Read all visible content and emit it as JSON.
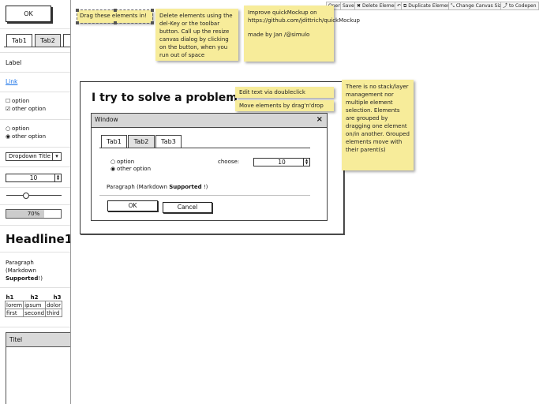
{
  "toolbar": {
    "open": "Open",
    "save": "Save",
    "delete": "Delete Element",
    "undo": "↶",
    "duplicate": "Duplicate Element",
    "resize": "Change Canvas Size",
    "codepen": "to Codepen"
  },
  "palette": {
    "button_label": "OK",
    "tabs": [
      "Tab1",
      "Tab2"
    ],
    "label": "Label",
    "link": "Link",
    "checkboxes": [
      "option",
      "other option"
    ],
    "radios": [
      "option",
      "other option"
    ],
    "dropdown_label": "Dropdown Title",
    "dropdown_arrow": "▾",
    "number_value": "10",
    "slider_value": 0.35,
    "progress_label": "70%",
    "progress_value": 0.7,
    "headline": "Headline1",
    "paragraph_pre": "Paragraph (Markdown ",
    "paragraph_bold": "Supported",
    "paragraph_post": "!)",
    "table": {
      "header": [
        "h1",
        "h2",
        "h3"
      ],
      "rows": [
        [
          "lorem",
          "ipsum",
          "dolor"
        ],
        [
          "first",
          "second",
          "third"
        ]
      ]
    },
    "panel_title": "Titel"
  },
  "notes": {
    "drag": "Drag these elements in!",
    "delete": "Delete elements using the del-Key or the toolbar button. Call up the resize canvas dialog by clicking on the button, when you run out of space",
    "improve_line1": "Improve quickMockup on https://github.com/jdittrich/quickMockup",
    "improve_line2": "made by Jan /@simulo",
    "edit": "Edit text via doubleclick",
    "move": "Move elements by drag'n'drop",
    "group": "There is no stack/layer management nor multiple element selection. Elements are grouped by dragging one element on/in another. Grouped elements move with their parent(s)"
  },
  "canvas": {
    "headline": "I try to solve a problem",
    "window": {
      "title": "Window",
      "close": "×",
      "tabs": [
        "Tab1",
        "Tab2",
        "Tab3"
      ],
      "radios": [
        "option",
        "other option"
      ],
      "choose_label": "choose:",
      "number_value": "10",
      "paragraph_pre": "Paragraph (Markdown ",
      "paragraph_bold": "Supported",
      "paragraph_post": " !)",
      "ok": "OK",
      "cancel": "Cancel"
    }
  }
}
